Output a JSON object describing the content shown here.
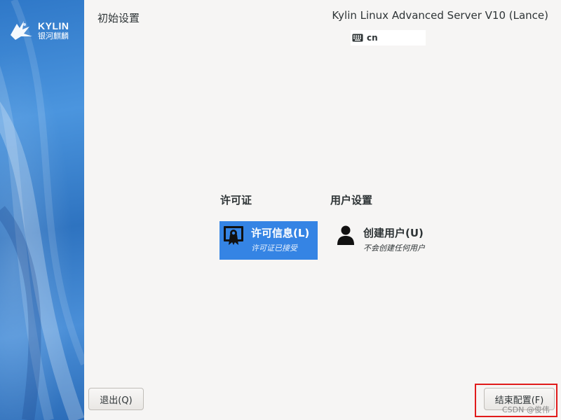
{
  "sidebar": {
    "logo_en": "KYLIN",
    "logo_zh": "银河麒麟"
  },
  "header": {
    "title": "初始设置",
    "product": "Kylin Linux Advanced Server V10 (Lance)",
    "keyboard_layout": "cn",
    "keyboard_icon": "keyboard-icon"
  },
  "sections": {
    "license": {
      "title": "许可证",
      "spoke_label": "许可信息(L)",
      "spoke_status": "许可证已接受",
      "icon": "certificate-icon",
      "selected": true
    },
    "user": {
      "title": "用户设置",
      "spoke_label": "创建用户(U)",
      "spoke_status": "不会创建任何用户",
      "icon": "user-icon"
    }
  },
  "footer": {
    "quit_label": "退出(Q)",
    "finish_label": "结束配置(F)",
    "watermark": "CSDN @俊伟"
  },
  "colors": {
    "accent": "#3584e4",
    "sidebar": "#3a85d2",
    "highlight": "#e01b1b"
  }
}
